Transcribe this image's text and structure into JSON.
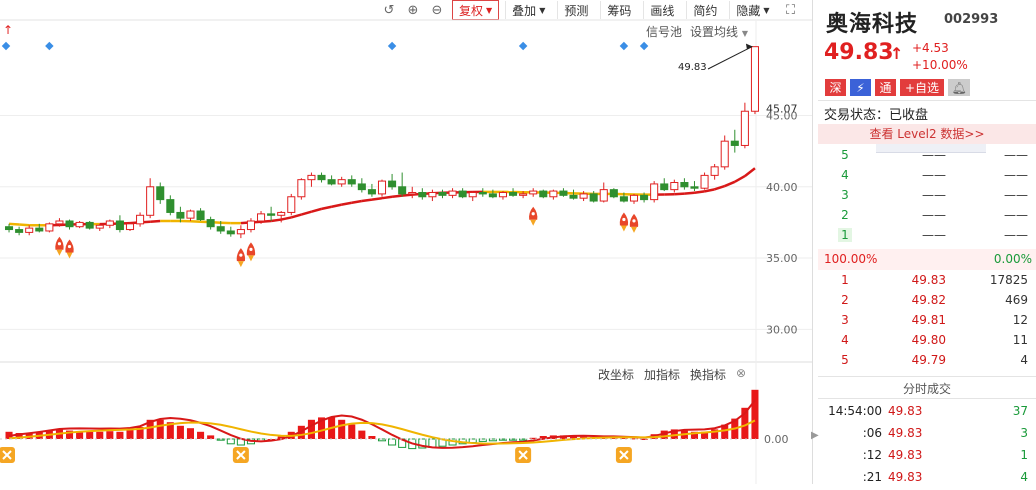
{
  "toolbar": {
    "fuquan": "复权",
    "diejia": "叠加",
    "yuce": "预测",
    "chouma": "筹码",
    "huaxian": "画线",
    "jianyue": "简约",
    "yincang": "隐藏"
  },
  "chart": {
    "xinhaochi": "信号池",
    "shezhi_junxian": "设置均线",
    "high_marker": "49.83",
    "y_ticks": [
      "45.07",
      "45.00",
      "40.00",
      "35.00",
      "30.00"
    ],
    "sub_y_tick": "0.00",
    "indicator_links": [
      "改坐标",
      "加指标",
      "换指标"
    ]
  },
  "colors": {
    "up": "#e02020",
    "down": "#2f8f2f",
    "ma_yellow": "#f0b400",
    "ma_red": "#d81818"
  },
  "quote": {
    "name": "奥海科技",
    "code": "002993",
    "price": "49.83",
    "change": "+4.53",
    "change_pct": "+10.00%",
    "badges": [
      "深",
      "⚡",
      "通",
      "+自选"
    ],
    "status": "交易状态：已收盘",
    "level2": "查看 Level2 数据>>"
  },
  "orderbook": {
    "sell": [
      {
        "level": "5",
        "price": "——",
        "vol": "——"
      },
      {
        "level": "4",
        "price": "——",
        "vol": "——"
      },
      {
        "level": "3",
        "price": "——",
        "vol": "——"
      },
      {
        "level": "2",
        "price": "——",
        "vol": "——"
      },
      {
        "level": "1",
        "price": "——",
        "vol": "——"
      }
    ],
    "ratio_left": "100.00%",
    "ratio_right": "0.00%",
    "buy": [
      {
        "level": "1",
        "price": "49.83",
        "vol": "17825"
      },
      {
        "level": "2",
        "price": "49.82",
        "vol": "469"
      },
      {
        "level": "3",
        "price": "49.81",
        "vol": "12"
      },
      {
        "level": "4",
        "price": "49.80",
        "vol": "11"
      },
      {
        "level": "5",
        "price": "49.79",
        "vol": "4"
      }
    ]
  },
  "ticks": {
    "title": "分时成交",
    "rows": [
      {
        "time": "14:54:00",
        "price": "49.83",
        "vol": "37"
      },
      {
        "time": ":06",
        "price": "49.83",
        "vol": "3"
      },
      {
        "time": ":12",
        "price": "49.83",
        "vol": "1"
      },
      {
        "time": ":21",
        "price": "49.83",
        "vol": "4"
      }
    ]
  },
  "candles": [
    [
      37.2,
      37.4,
      36.8,
      37.0
    ],
    [
      37.0,
      37.2,
      36.6,
      36.8
    ],
    [
      36.8,
      37.3,
      36.6,
      37.1
    ],
    [
      37.1,
      37.4,
      36.8,
      36.9
    ],
    [
      36.9,
      37.5,
      36.8,
      37.4
    ],
    [
      37.4,
      37.8,
      37.2,
      37.6
    ],
    [
      37.6,
      37.7,
      37.0,
      37.2
    ],
    [
      37.2,
      37.6,
      37.1,
      37.5
    ],
    [
      37.5,
      37.6,
      37.0,
      37.1
    ],
    [
      37.1,
      37.4,
      36.9,
      37.3
    ],
    [
      37.3,
      37.7,
      37.1,
      37.6
    ],
    [
      37.6,
      38.0,
      36.8,
      37.0
    ],
    [
      37.0,
      37.5,
      36.9,
      37.4
    ],
    [
      37.4,
      38.2,
      37.2,
      38.0
    ],
    [
      38.0,
      40.6,
      37.8,
      40.0
    ],
    [
      40.0,
      40.3,
      38.8,
      39.1
    ],
    [
      39.1,
      39.4,
      38.0,
      38.2
    ],
    [
      38.2,
      38.6,
      37.5,
      37.8
    ],
    [
      37.8,
      38.4,
      37.6,
      38.3
    ],
    [
      38.3,
      38.5,
      37.6,
      37.7
    ],
    [
      37.7,
      37.9,
      37.0,
      37.2
    ],
    [
      37.2,
      37.6,
      36.7,
      36.9
    ],
    [
      36.9,
      37.2,
      36.5,
      36.7
    ],
    [
      36.7,
      37.3,
      36.4,
      37.0
    ],
    [
      37.0,
      37.8,
      36.8,
      37.6
    ],
    [
      37.6,
      38.3,
      37.4,
      38.1
    ],
    [
      38.1,
      38.6,
      37.6,
      38.0
    ],
    [
      38.0,
      38.3,
      37.5,
      38.2
    ],
    [
      38.2,
      39.5,
      38.0,
      39.3
    ],
    [
      39.3,
      40.6,
      39.1,
      40.5
    ],
    [
      40.5,
      41.0,
      40.0,
      40.8
    ],
    [
      40.8,
      41.0,
      40.3,
      40.5
    ],
    [
      40.5,
      40.8,
      40.1,
      40.2
    ],
    [
      40.2,
      40.7,
      40.0,
      40.5
    ],
    [
      40.5,
      40.8,
      40.0,
      40.2
    ],
    [
      40.2,
      40.6,
      39.6,
      39.8
    ],
    [
      39.8,
      40.2,
      39.3,
      39.5
    ],
    [
      39.5,
      40.5,
      39.3,
      40.4
    ],
    [
      40.4,
      40.9,
      39.8,
      40.0
    ],
    [
      40.0,
      41.0,
      39.3,
      39.5
    ],
    [
      39.5,
      40.0,
      39.2,
      39.6
    ],
    [
      39.6,
      39.9,
      39.1,
      39.3
    ],
    [
      39.3,
      39.8,
      39.0,
      39.6
    ],
    [
      39.6,
      39.8,
      39.2,
      39.4
    ],
    [
      39.4,
      39.9,
      39.2,
      39.7
    ],
    [
      39.7,
      39.9,
      39.2,
      39.3
    ],
    [
      39.3,
      39.7,
      39.0,
      39.6
    ],
    [
      39.6,
      39.9,
      39.3,
      39.5
    ],
    [
      39.5,
      39.8,
      39.2,
      39.3
    ],
    [
      39.3,
      39.7,
      39.1,
      39.6
    ],
    [
      39.6,
      39.9,
      39.3,
      39.4
    ],
    [
      39.4,
      39.7,
      39.2,
      39.5
    ],
    [
      39.5,
      39.9,
      39.3,
      39.7
    ],
    [
      39.7,
      39.8,
      39.2,
      39.3
    ],
    [
      39.3,
      39.8,
      39.1,
      39.7
    ],
    [
      39.7,
      39.9,
      39.3,
      39.4
    ],
    [
      39.4,
      39.8,
      39.1,
      39.2
    ],
    [
      39.2,
      39.7,
      39.0,
      39.5
    ],
    [
      39.5,
      39.7,
      38.9,
      39.0
    ],
    [
      39.0,
      40.3,
      38.9,
      39.8
    ],
    [
      39.8,
      39.9,
      39.2,
      39.3
    ],
    [
      39.3,
      39.6,
      38.9,
      39.0
    ],
    [
      39.0,
      39.5,
      38.8,
      39.4
    ],
    [
      39.4,
      39.6,
      38.9,
      39.1
    ],
    [
      39.1,
      40.4,
      38.9,
      40.2
    ],
    [
      40.2,
      40.6,
      39.7,
      39.8
    ],
    [
      39.8,
      40.5,
      39.6,
      40.3
    ],
    [
      40.3,
      40.6,
      39.8,
      40.0
    ],
    [
      40.0,
      40.4,
      39.7,
      39.9
    ],
    [
      39.9,
      41.0,
      39.8,
      40.8
    ],
    [
      40.8,
      41.6,
      40.5,
      41.4
    ],
    [
      41.4,
      43.6,
      41.2,
      43.2
    ],
    [
      43.2,
      44.0,
      42.4,
      42.9
    ],
    [
      42.9,
      45.9,
      42.7,
      45.3
    ],
    [
      45.3,
      49.83,
      45.1,
      49.83
    ]
  ],
  "ma": [
    37.4,
    37.35,
    37.3,
    37.3,
    37.3,
    37.32,
    37.35,
    37.37,
    37.38,
    37.38,
    37.4,
    37.42,
    37.45,
    37.5,
    37.55,
    37.6,
    37.6,
    37.6,
    37.58,
    37.55,
    37.52,
    37.48,
    37.45,
    37.45,
    37.5,
    37.55,
    37.6,
    37.7,
    37.85,
    38.05,
    38.25,
    38.45,
    38.6,
    38.75,
    38.88,
    39.0,
    39.1,
    39.2,
    39.3,
    39.38,
    39.45,
    39.5,
    39.55,
    39.58,
    39.6,
    39.62,
    39.63,
    39.64,
    39.64,
    39.64,
    39.63,
    39.62,
    39.61,
    39.6,
    39.58,
    39.56,
    39.54,
    39.52,
    39.5,
    39.5,
    39.5,
    39.48,
    39.46,
    39.45,
    39.45,
    39.46,
    39.48,
    39.52,
    39.58,
    39.68,
    39.82,
    40.05,
    40.35,
    40.75,
    41.3
  ],
  "macd_hist": [
    0.12,
    0.1,
    0.1,
    0.12,
    0.14,
    0.16,
    0.14,
    0.13,
    0.12,
    0.12,
    0.13,
    0.12,
    0.15,
    0.2,
    0.32,
    0.32,
    0.28,
    0.22,
    0.18,
    0.12,
    0.06,
    -0.02,
    -0.08,
    -0.1,
    -0.08,
    -0.04,
    0.0,
    0.04,
    0.12,
    0.22,
    0.32,
    0.36,
    0.36,
    0.32,
    0.24,
    0.14,
    0.05,
    -0.03,
    -0.1,
    -0.14,
    -0.16,
    -0.15,
    -0.14,
    -0.12,
    -0.1,
    -0.08,
    -0.06,
    -0.04,
    -0.03,
    -0.02,
    -0.02,
    -0.02,
    0.02,
    0.05,
    0.06,
    0.06,
    0.05,
    0.04,
    0.03,
    0.02,
    0.03,
    0.02,
    0.01,
    0.0,
    0.08,
    0.14,
    0.16,
    0.14,
    0.12,
    0.12,
    0.16,
    0.24,
    0.34,
    0.52,
    0.82
  ],
  "signals_diamond_idx": [
    0,
    4,
    38,
    51,
    61,
    63
  ],
  "signals_rocket_idx": [
    5,
    6,
    23,
    24,
    52,
    61,
    62
  ],
  "signals_x_idx": [
    0,
    23,
    51,
    61
  ]
}
